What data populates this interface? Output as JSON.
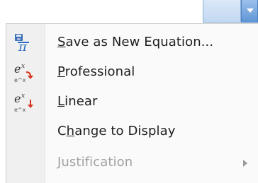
{
  "menu": {
    "items": [
      {
        "pre": "",
        "accel": "S",
        "post": "ave as New Equation...",
        "icon": "save-equation-icon",
        "enabled": true
      },
      {
        "pre": "",
        "accel": "P",
        "post": "rofessional",
        "icon": "professional-format-icon",
        "enabled": true
      },
      {
        "pre": "",
        "accel": "L",
        "post": "inear",
        "icon": "linear-format-icon",
        "enabled": true
      },
      {
        "pre": "C",
        "accel": "h",
        "post": "ange to Display",
        "icon": "",
        "enabled": true
      },
      {
        "pre": "",
        "accel": "J",
        "post": "ustification",
        "icon": "",
        "enabled": false,
        "submenu": true
      }
    ]
  },
  "icons": {
    "professional_badge_text": "e^x",
    "linear_badge_text": "e^x"
  },
  "colors": {
    "accent_blue": "#2f6fc2",
    "accent_red": "#d4341f",
    "disabled_text": "#a0a0a0"
  }
}
